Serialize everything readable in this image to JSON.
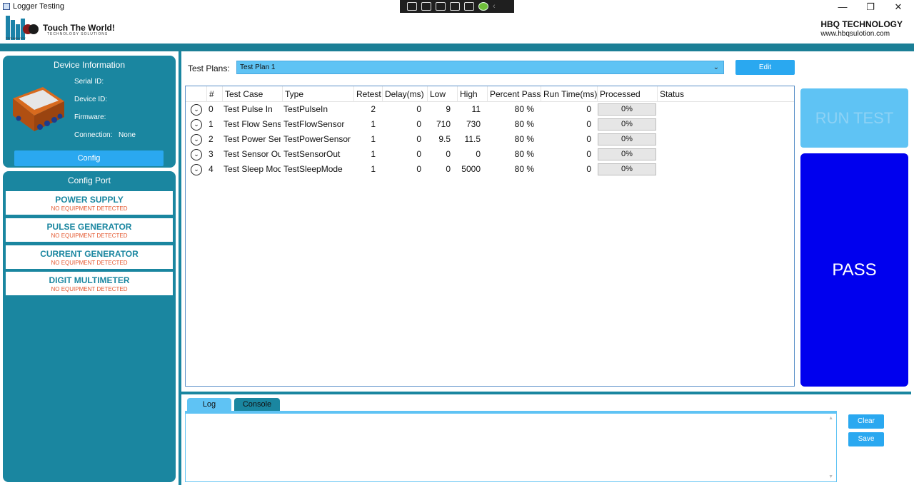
{
  "window": {
    "title": "Logger Testing",
    "controls": {
      "minimize": "—",
      "restore": "❐",
      "close": "✕"
    }
  },
  "header": {
    "logo_tagline": "Touch The World!",
    "logo_sub": "TECHNOLOGY SOLUTIONS",
    "logo_mini": "TECHNOLOGY",
    "company_name": "HBQ TECHNOLOGY",
    "company_url": "www.hbqsulotion.com"
  },
  "device_info": {
    "title": "Device Information",
    "serial_label": "Serial ID:",
    "device_label": "Device ID:",
    "firmware_label": "Firmware:",
    "connection_label": "Connection:",
    "connection_value": "None",
    "config_button": "Config"
  },
  "config_port": {
    "title": "Config Port",
    "items": [
      {
        "name": "POWER SUPPLY",
        "status": "NO EQUIPMENT DETECTED"
      },
      {
        "name": "PULSE GENERATOR",
        "status": "NO EQUIPMENT DETECTED"
      },
      {
        "name": "CURRENT GENERATOR",
        "status": "NO EQUIPMENT DETECTED"
      },
      {
        "name": "DIGIT MULTIMETER",
        "status": "NO EQUIPMENT DETECTED"
      }
    ]
  },
  "test_plan": {
    "label": "Test Plans:",
    "selected": "Test Plan 1",
    "edit_button": "Edit"
  },
  "grid": {
    "headers": [
      "#",
      "Test Case",
      "Type",
      "Retest",
      "Delay(ms)",
      "Low",
      "High",
      "Percent Pass",
      "Run Time(ms)",
      "Processed",
      "Status"
    ],
    "rows": [
      {
        "index": "0",
        "test_case": "Test Pulse In",
        "type": "TestPulseIn",
        "retest": "2",
        "delay": "0",
        "low": "9",
        "high": "11",
        "percent": "80 %",
        "runtime": "0",
        "processed": "0%",
        "status": ""
      },
      {
        "index": "1",
        "test_case": "Test Flow Sensor",
        "type": "TestFlowSensor",
        "retest": "1",
        "delay": "0",
        "low": "710",
        "high": "730",
        "percent": "80 %",
        "runtime": "0",
        "processed": "0%",
        "status": ""
      },
      {
        "index": "2",
        "test_case": "Test Power Sensor",
        "type": "TestPowerSensor",
        "retest": "1",
        "delay": "0",
        "low": "9.5",
        "high": "11.5",
        "percent": "80 %",
        "runtime": "0",
        "processed": "0%",
        "status": ""
      },
      {
        "index": "3",
        "test_case": "Test Sensor Out",
        "type": "TestSensorOut",
        "retest": "1",
        "delay": "0",
        "low": "0",
        "high": "0",
        "percent": "80 %",
        "runtime": "0",
        "processed": "0%",
        "status": ""
      },
      {
        "index": "4",
        "test_case": "Test Sleep Mode",
        "type": "TestSleepMode",
        "retest": "1",
        "delay": "0",
        "low": "0",
        "high": "5000",
        "percent": "80 %",
        "runtime": "0",
        "processed": "0%",
        "status": ""
      }
    ]
  },
  "actions": {
    "run_test": "RUN TEST",
    "result": "PASS"
  },
  "bottom": {
    "tabs": [
      "Log",
      "Console"
    ],
    "log_content": "",
    "clear_button": "Clear",
    "save_button": "Save"
  },
  "colors": {
    "teal": "#1a86a0",
    "light_blue": "#5fc3f4",
    "button_blue": "#2aa8f0",
    "pass_blue": "#0000ee",
    "warning": "#e4572e"
  }
}
